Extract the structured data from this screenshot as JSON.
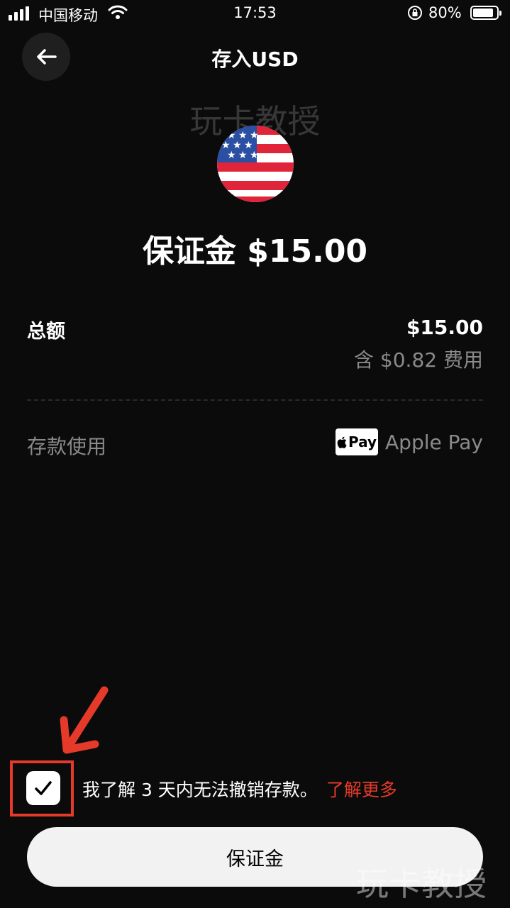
{
  "status_bar": {
    "carrier": "中国移动",
    "time": "17:53",
    "battery": "80%"
  },
  "header": {
    "title": "存入USD",
    "back_icon": "arrow-left-icon"
  },
  "watermark": "玩卡教授",
  "currency": {
    "flag_icon": "us-flag-icon"
  },
  "headline": "保证金 $15.00",
  "summary": {
    "total_label": "总额",
    "total_value": "$15.00",
    "fee_text": "含 $0.82 费用"
  },
  "payment": {
    "label": "存款使用",
    "badge": "Pay",
    "method": "Apple Pay"
  },
  "consent": {
    "checked": true,
    "text": "我了解 3 天内无法撤销存款。",
    "link": "了解更多"
  },
  "cta_label": "保证金",
  "colors": {
    "background": "#0b0b0b",
    "accent_red": "#e53a2a",
    "button_bg": "#f2f2f2"
  }
}
